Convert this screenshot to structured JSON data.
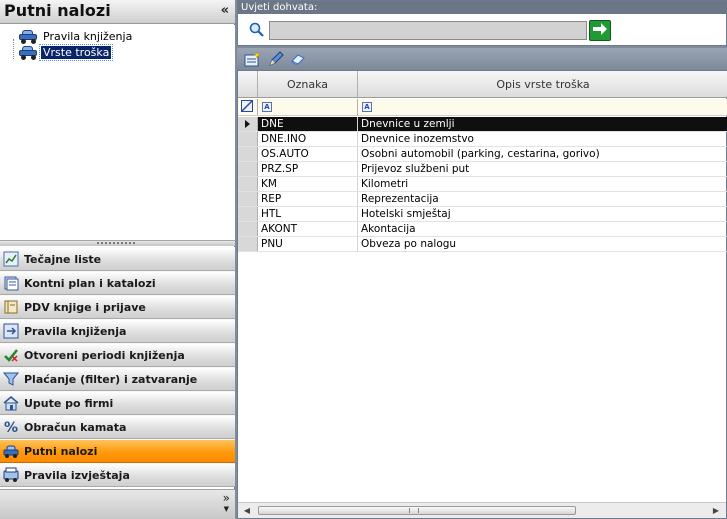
{
  "left_panel": {
    "title": "Putni nalozi",
    "collapse_glyph": "«",
    "tree": [
      {
        "label": "Pravila knjiženja",
        "icon": "car-icon",
        "selected": false
      },
      {
        "label": "Vrste troška",
        "icon": "car-icon",
        "selected": true
      }
    ],
    "nav": [
      {
        "label": "Tečajne liste",
        "icon": "chart-icon"
      },
      {
        "label": "Kontni plan i katalozi",
        "icon": "catalog-icon"
      },
      {
        "label": "PDV knjige i prijave",
        "icon": "book-icon"
      },
      {
        "label": "Pravila knjiženja",
        "icon": "rules-icon"
      },
      {
        "label": "Otvoreni periodi knjiženja",
        "icon": "check-icon"
      },
      {
        "label": "Plaćanje (filter) i zatvaranje",
        "icon": "filter-icon"
      },
      {
        "label": "Upute po firmi",
        "icon": "house-icon"
      },
      {
        "label": "Obračun kamata",
        "icon": "percent-icon"
      },
      {
        "label": "Putni nalozi",
        "icon": "car-icon",
        "active": true
      },
      {
        "label": "Pravila izvještaja",
        "icon": "report-icon"
      }
    ],
    "more_glyph": "»"
  },
  "search": {
    "caption": "Uvjeti dohvata:",
    "value": "",
    "placeholder": ""
  },
  "grid": {
    "columns": [
      "Oznaka",
      "Opis vrste troška"
    ],
    "rows": [
      {
        "code": "DNE",
        "desc": "Dnevnice u zemlji",
        "selected": true
      },
      {
        "code": "DNE.INO",
        "desc": "Dnevnice inozemstvo"
      },
      {
        "code": "OS.AUTO",
        "desc": "Osobni automobil (parking, cestarina, gorivo)"
      },
      {
        "code": "PRZ.SP",
        "desc": "Prijevoz službeni put"
      },
      {
        "code": "KM",
        "desc": "Kilometri"
      },
      {
        "code": "REP",
        "desc": "Reprezentacija"
      },
      {
        "code": "HTL",
        "desc": "Hotelski smještaj"
      },
      {
        "code": "AKONT",
        "desc": "Akontacija"
      },
      {
        "code": "PNU",
        "desc": "Obveza po nalogu"
      }
    ]
  },
  "colors": {
    "active_nav": "#ff9a0d",
    "selected_row": "#0f0f0f",
    "tree_selection": "#0a246a",
    "go_button": "#1f9a34"
  }
}
